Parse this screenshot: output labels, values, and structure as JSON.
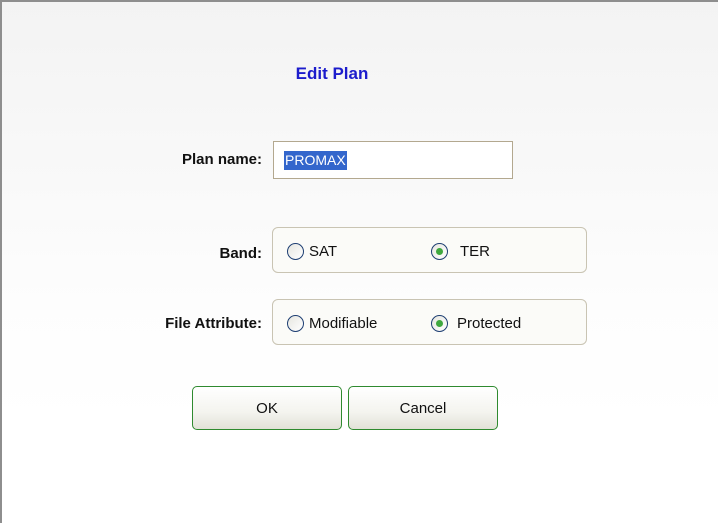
{
  "dialog": {
    "title": "Edit Plan"
  },
  "plan_name": {
    "label": "Plan name:",
    "value": "PROMAX"
  },
  "band": {
    "label": "Band:",
    "options": [
      {
        "label": "SAT",
        "checked": false
      },
      {
        "label": "TER",
        "checked": true
      }
    ]
  },
  "file_attribute": {
    "label": "File Attribute:",
    "options": [
      {
        "label": "Modifiable",
        "checked": false
      },
      {
        "label": "Protected",
        "checked": true
      }
    ]
  },
  "buttons": {
    "ok_label": "OK",
    "cancel_label": "Cancel"
  },
  "colors": {
    "title": "#1c1ccc",
    "selection": "#3366cc",
    "radio_dot": "#3fa83f",
    "button_border": "#2f8a2f"
  }
}
